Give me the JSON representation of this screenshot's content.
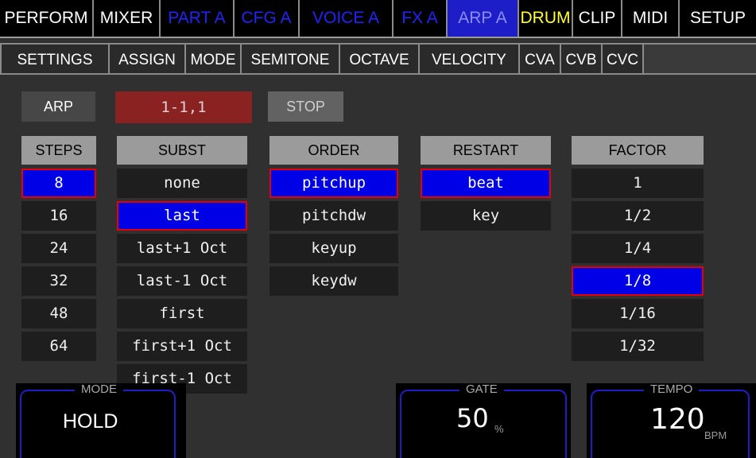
{
  "top_tabs": [
    {
      "label": "PERFORM",
      "style": "white"
    },
    {
      "label": "MIXER",
      "style": "white"
    },
    {
      "label": "PART A",
      "style": "blue"
    },
    {
      "label": "CFG A",
      "style": "blue"
    },
    {
      "label": "VOICE A",
      "style": "blue"
    },
    {
      "label": "FX A",
      "style": "blue"
    },
    {
      "label": "ARP A",
      "style": "active"
    },
    {
      "label": "DRUM",
      "style": "yellow"
    },
    {
      "label": "CLIP",
      "style": "white"
    },
    {
      "label": "MIDI",
      "style": "white"
    },
    {
      "label": "SETUP",
      "style": "white"
    }
  ],
  "sub_tabs": [
    "SETTINGS",
    "ASSIGN",
    "MODE",
    "SEMITONE",
    "OCTAVE",
    "VELOCITY",
    "CVA",
    "CVB",
    "CVC"
  ],
  "controls": {
    "arp_label": "ARP",
    "position": "1-1,1",
    "stop_label": "STOP"
  },
  "columns": {
    "steps": {
      "header": "STEPS",
      "items": [
        "8",
        "16",
        "24",
        "32",
        "48",
        "64"
      ],
      "selected": 0
    },
    "subst": {
      "header": "SUBST",
      "items": [
        "none",
        "last",
        "last+1 Oct",
        "last-1 Oct",
        "first",
        "first+1 Oct",
        "first-1 Oct"
      ],
      "selected": 1
    },
    "order": {
      "header": "ORDER",
      "items": [
        "pitchup",
        "pitchdw",
        "keyup",
        "keydw"
      ],
      "selected": 0
    },
    "restart": {
      "header": "RESTART",
      "items": [
        "beat",
        "key"
      ],
      "selected": 0
    },
    "factor": {
      "header": "FACTOR",
      "items": [
        "1",
        "1/2",
        "1/4",
        "1/8",
        "1/16",
        "1/32"
      ],
      "selected": 3
    }
  },
  "panels": {
    "mode": {
      "title": "MODE",
      "value": "HOLD"
    },
    "gate": {
      "title": "GATE",
      "value": "50",
      "unit": "%"
    },
    "tempo": {
      "title": "TEMPO",
      "value": "120",
      "unit": "BPM"
    }
  },
  "colors": {
    "accent_blue": "#0000e6",
    "select_border": "#e60000",
    "position_bg": "#8a2222",
    "drum_yellow": "#ffff2a"
  }
}
